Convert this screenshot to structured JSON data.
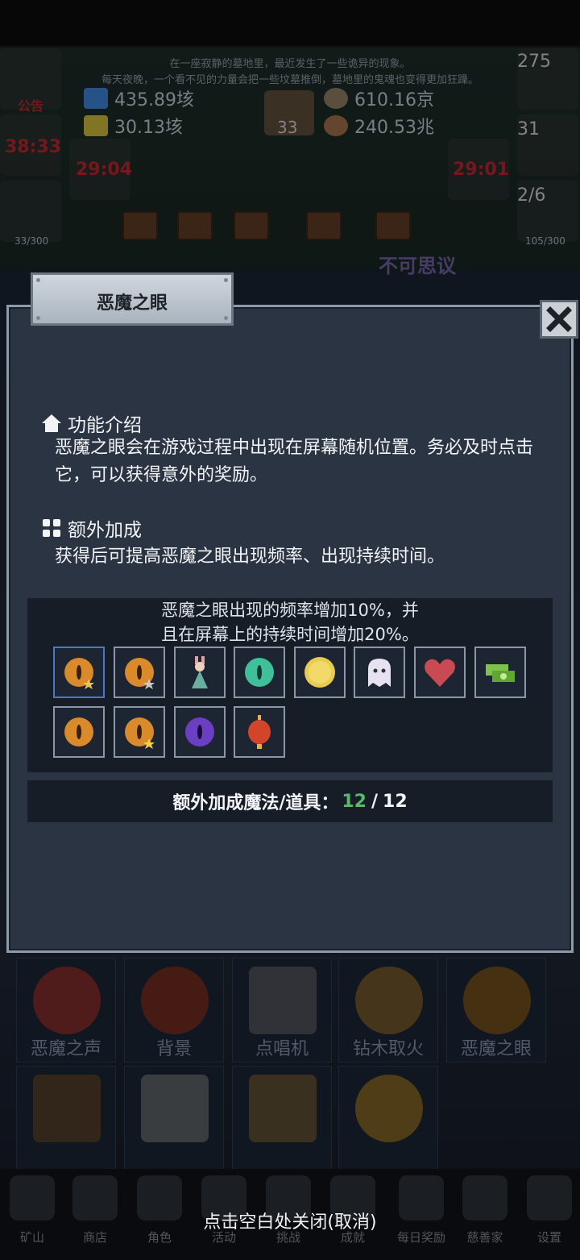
{
  "story": {
    "line1": "在一座寂静的墓地里，最近发生了一些诡异的现象。",
    "line2": "每天夜晚，一个看不见的力量会把一些坟墓推倒，墓地里的鬼魂也变得更加狂躁。"
  },
  "resources": {
    "r1": "435.89垓",
    "r2": "30.13垓",
    "r3": "610.16京",
    "r4": "240.53兆",
    "book_count": "33"
  },
  "side": {
    "notice": "公告",
    "timer_left": "38:33",
    "timer_mid_left": "29:04",
    "timer_mid_right": "29:01",
    "potion_count": "275",
    "chest_count": "31",
    "slime_count": "2/6",
    "left_cap": "33/300",
    "right_cap": "105/300",
    "floating": "不可思议"
  },
  "dialog": {
    "title": "恶魔之眼",
    "section1_title": "功能介绍",
    "section1_body": "恶魔之眼会在游戏过程中出现在屏幕随机位置。务必及时点击它，可以获得意外的奖励。",
    "section2_title": "额外加成",
    "section2_body": "获得后可提高恶魔之眼出现频率、出现持续时间。",
    "bonus_line1": "恶魔之眼出现的频率增加10%，并",
    "bonus_line2": "且在屏幕上的持续时间增加20%。",
    "count_label": "额外加成魔法/道具：",
    "count_current": "12",
    "count_sep": "/",
    "count_total": "12"
  },
  "slots": [
    {
      "icon": "golden-eye-star-icon",
      "color": "#d98a2a"
    },
    {
      "icon": "golden-eye-silver-star-icon",
      "color": "#d98a2a"
    },
    {
      "icon": "rabbit-girl-icon",
      "color": "#e2a0a6"
    },
    {
      "icon": "green-eye-icon",
      "color": "#3fbf9a"
    },
    {
      "icon": "gold-coin-icon",
      "color": "#e8cc52"
    },
    {
      "icon": "ghost-icon",
      "color": "#e6e2f2"
    },
    {
      "icon": "heart-icon",
      "color": "#c94a52"
    },
    {
      "icon": "cash-stack-icon",
      "color": "#7fc24a"
    },
    {
      "icon": "amber-eye-icon",
      "color": "#d98a2a"
    },
    {
      "icon": "amber-eye-gold-star-icon",
      "color": "#d98a2a"
    },
    {
      "icon": "purple-eye-icon",
      "color": "#6a3fc2"
    },
    {
      "icon": "red-lantern-icon",
      "color": "#d2452a"
    }
  ],
  "bg_cards": [
    {
      "label": "恶魔之声"
    },
    {
      "label": "背景"
    },
    {
      "label": "点唱机"
    },
    {
      "label": "钻木取火"
    },
    {
      "label": "恶魔之眼"
    }
  ],
  "nav": [
    {
      "label": "矿山"
    },
    {
      "label": "商店"
    },
    {
      "label": "角色"
    },
    {
      "label": "活动"
    },
    {
      "label": "挑战"
    },
    {
      "label": "成就"
    },
    {
      "label": "每日奖励"
    },
    {
      "label": "慈善家"
    },
    {
      "label": "设置"
    }
  ],
  "close_hint": "点击空白处关闭(取消)"
}
